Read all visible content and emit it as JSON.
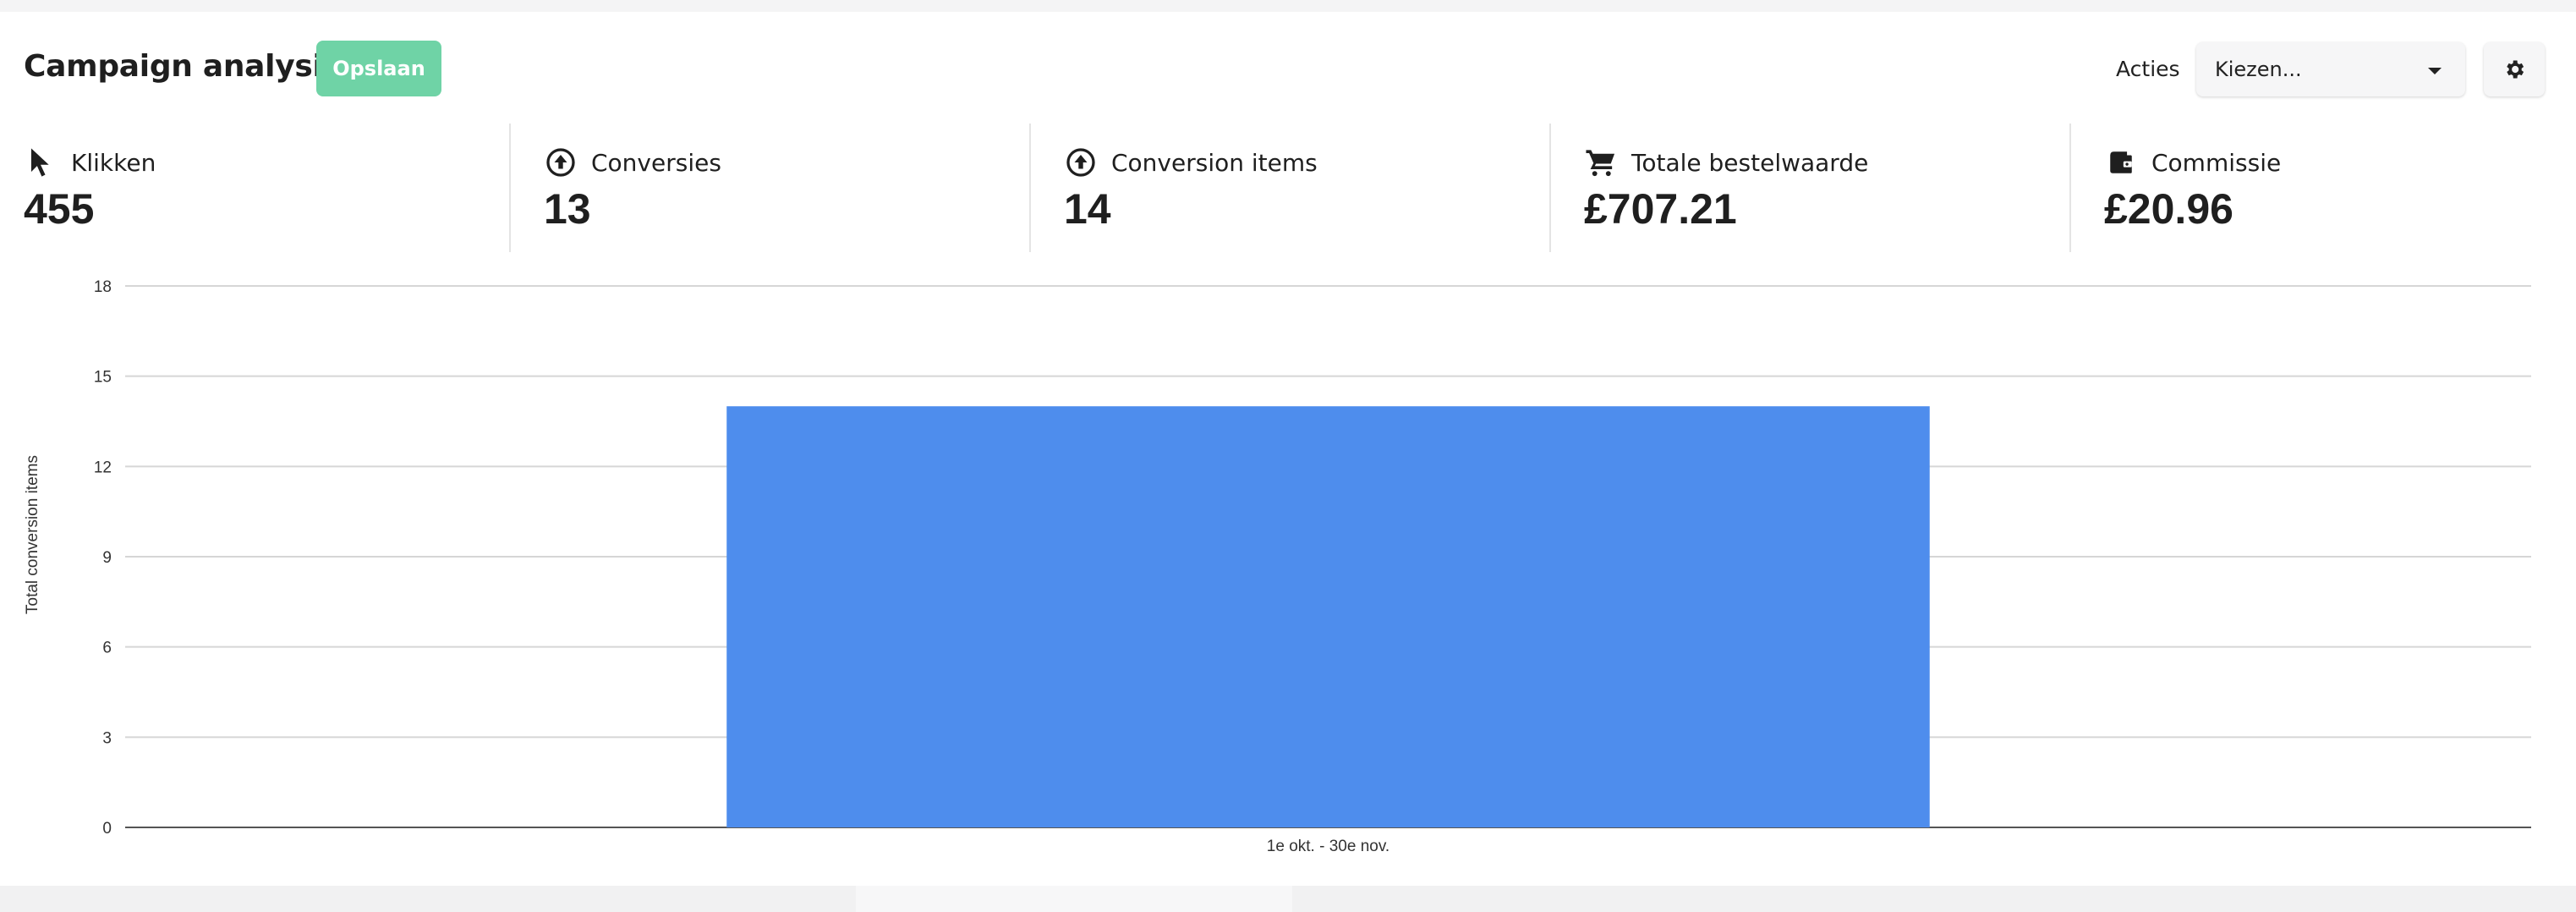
{
  "header": {
    "title": "Campaign analysis",
    "save_label": "Opslaan",
    "actions_label": "Acties",
    "select_value": "Kiezen..."
  },
  "kpis": [
    {
      "label": "Klikken",
      "value": "455",
      "icon": "cursor-icon"
    },
    {
      "label": "Conversies",
      "value": "13",
      "icon": "arrow-up-circle-icon"
    },
    {
      "label": "Conversion items",
      "value": "14",
      "icon": "arrow-up-circle-icon"
    },
    {
      "label": "Totale bestelwaarde",
      "value": "£707.21",
      "icon": "cart-icon"
    },
    {
      "label": "Commissie",
      "value": "£20.96",
      "icon": "wallet-icon"
    }
  ],
  "colors": {
    "accent": "#6fd3a6",
    "bar": "#4e8ded"
  },
  "chart_data": {
    "type": "bar",
    "categories": [
      "1e okt. - 30e nov."
    ],
    "values": [
      14
    ],
    "ylabel": "Total conversion items",
    "xlabel": "",
    "ylim": [
      0,
      18
    ],
    "yticks": [
      0,
      3,
      6,
      9,
      12,
      15,
      18
    ],
    "grid": true
  }
}
